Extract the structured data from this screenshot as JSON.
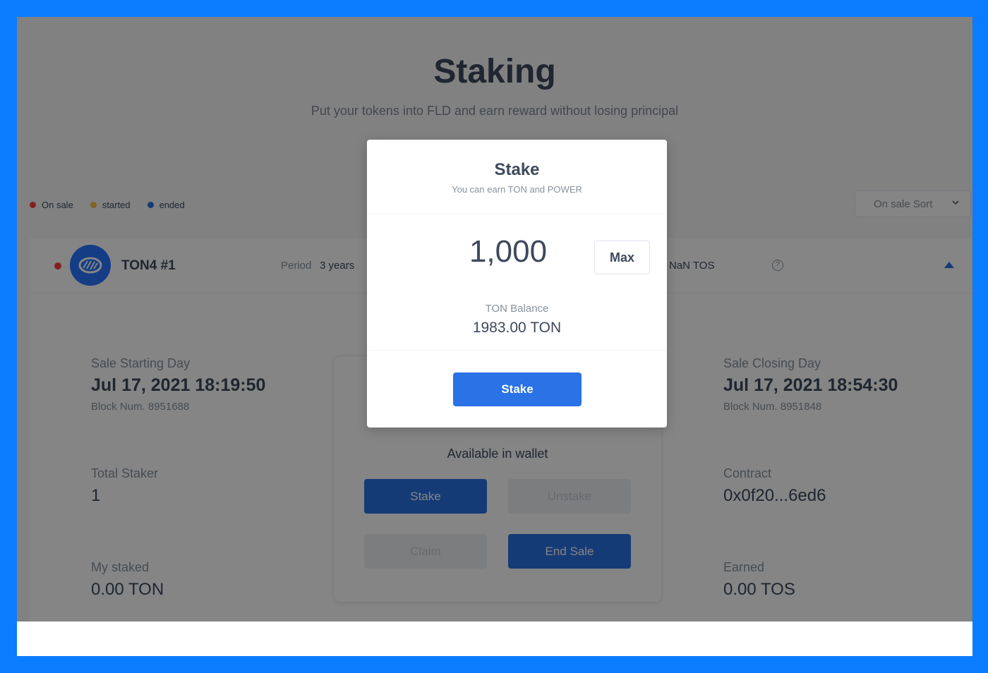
{
  "page": {
    "title": "Staking",
    "subtitle": "Put your tokens into FLD and earn reward without losing principal"
  },
  "legend": [
    {
      "label": "On sale",
      "color": "#f9423f"
    },
    {
      "label": "started",
      "color": "#f9c03e"
    },
    {
      "label": "ended",
      "color": "#2a72e5"
    }
  ],
  "sort": {
    "label": "On sale Sort"
  },
  "pool": {
    "name": "TON4 #1",
    "status_color": "#f9423f",
    "period_label": "Period",
    "period_value": "3 years",
    "reward_value": "NaN TOS",
    "help_glyph": "?"
  },
  "details": {
    "sale_start_label": "Sale Starting Day",
    "sale_start_value": "Jul 17, 2021 18:19:50",
    "sale_start_block": "Block Num. 8951688",
    "sale_close_label": "Sale Closing Day",
    "sale_close_value": "Jul 17, 2021 18:54:30",
    "sale_close_block": "Block Num. 8951848",
    "total_staker_label": "Total Staker",
    "total_staker_value": "1",
    "contract_label": "Contract",
    "contract_value": "0x0f20...6ed6",
    "my_staked_label": "My staked",
    "my_staked_value": "0.00 TON",
    "earned_label": "Earned",
    "earned_value": "0.00 TOS"
  },
  "actions": {
    "available_label": "Available in wallet",
    "stake": "Stake",
    "unstake": "Unstake",
    "claim": "Claim",
    "end_sale": "End Sale"
  },
  "modal": {
    "title": "Stake",
    "subtitle": "You can earn TON and POWER",
    "amount": "1,000",
    "max_label": "Max",
    "balance_label": "TON Balance",
    "balance_value": "1983.00 TON",
    "stake_button": "Stake"
  }
}
